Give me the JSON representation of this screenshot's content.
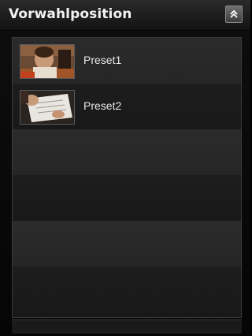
{
  "panel": {
    "title": "Vorwahlposition",
    "collapse_button_icon": "chevron-double-up-icon"
  },
  "presets": [
    {
      "label": "Preset1",
      "thumbnail": "preset-thumbnail-person"
    },
    {
      "label": "Preset2",
      "thumbnail": "preset-thumbnail-document"
    }
  ],
  "colors": {
    "background": "#000000",
    "header_text": "#f2f2f2",
    "row_odd": "#2b2b2b",
    "row_even": "#1d1d1d",
    "label_text": "#e8e8e8"
  }
}
